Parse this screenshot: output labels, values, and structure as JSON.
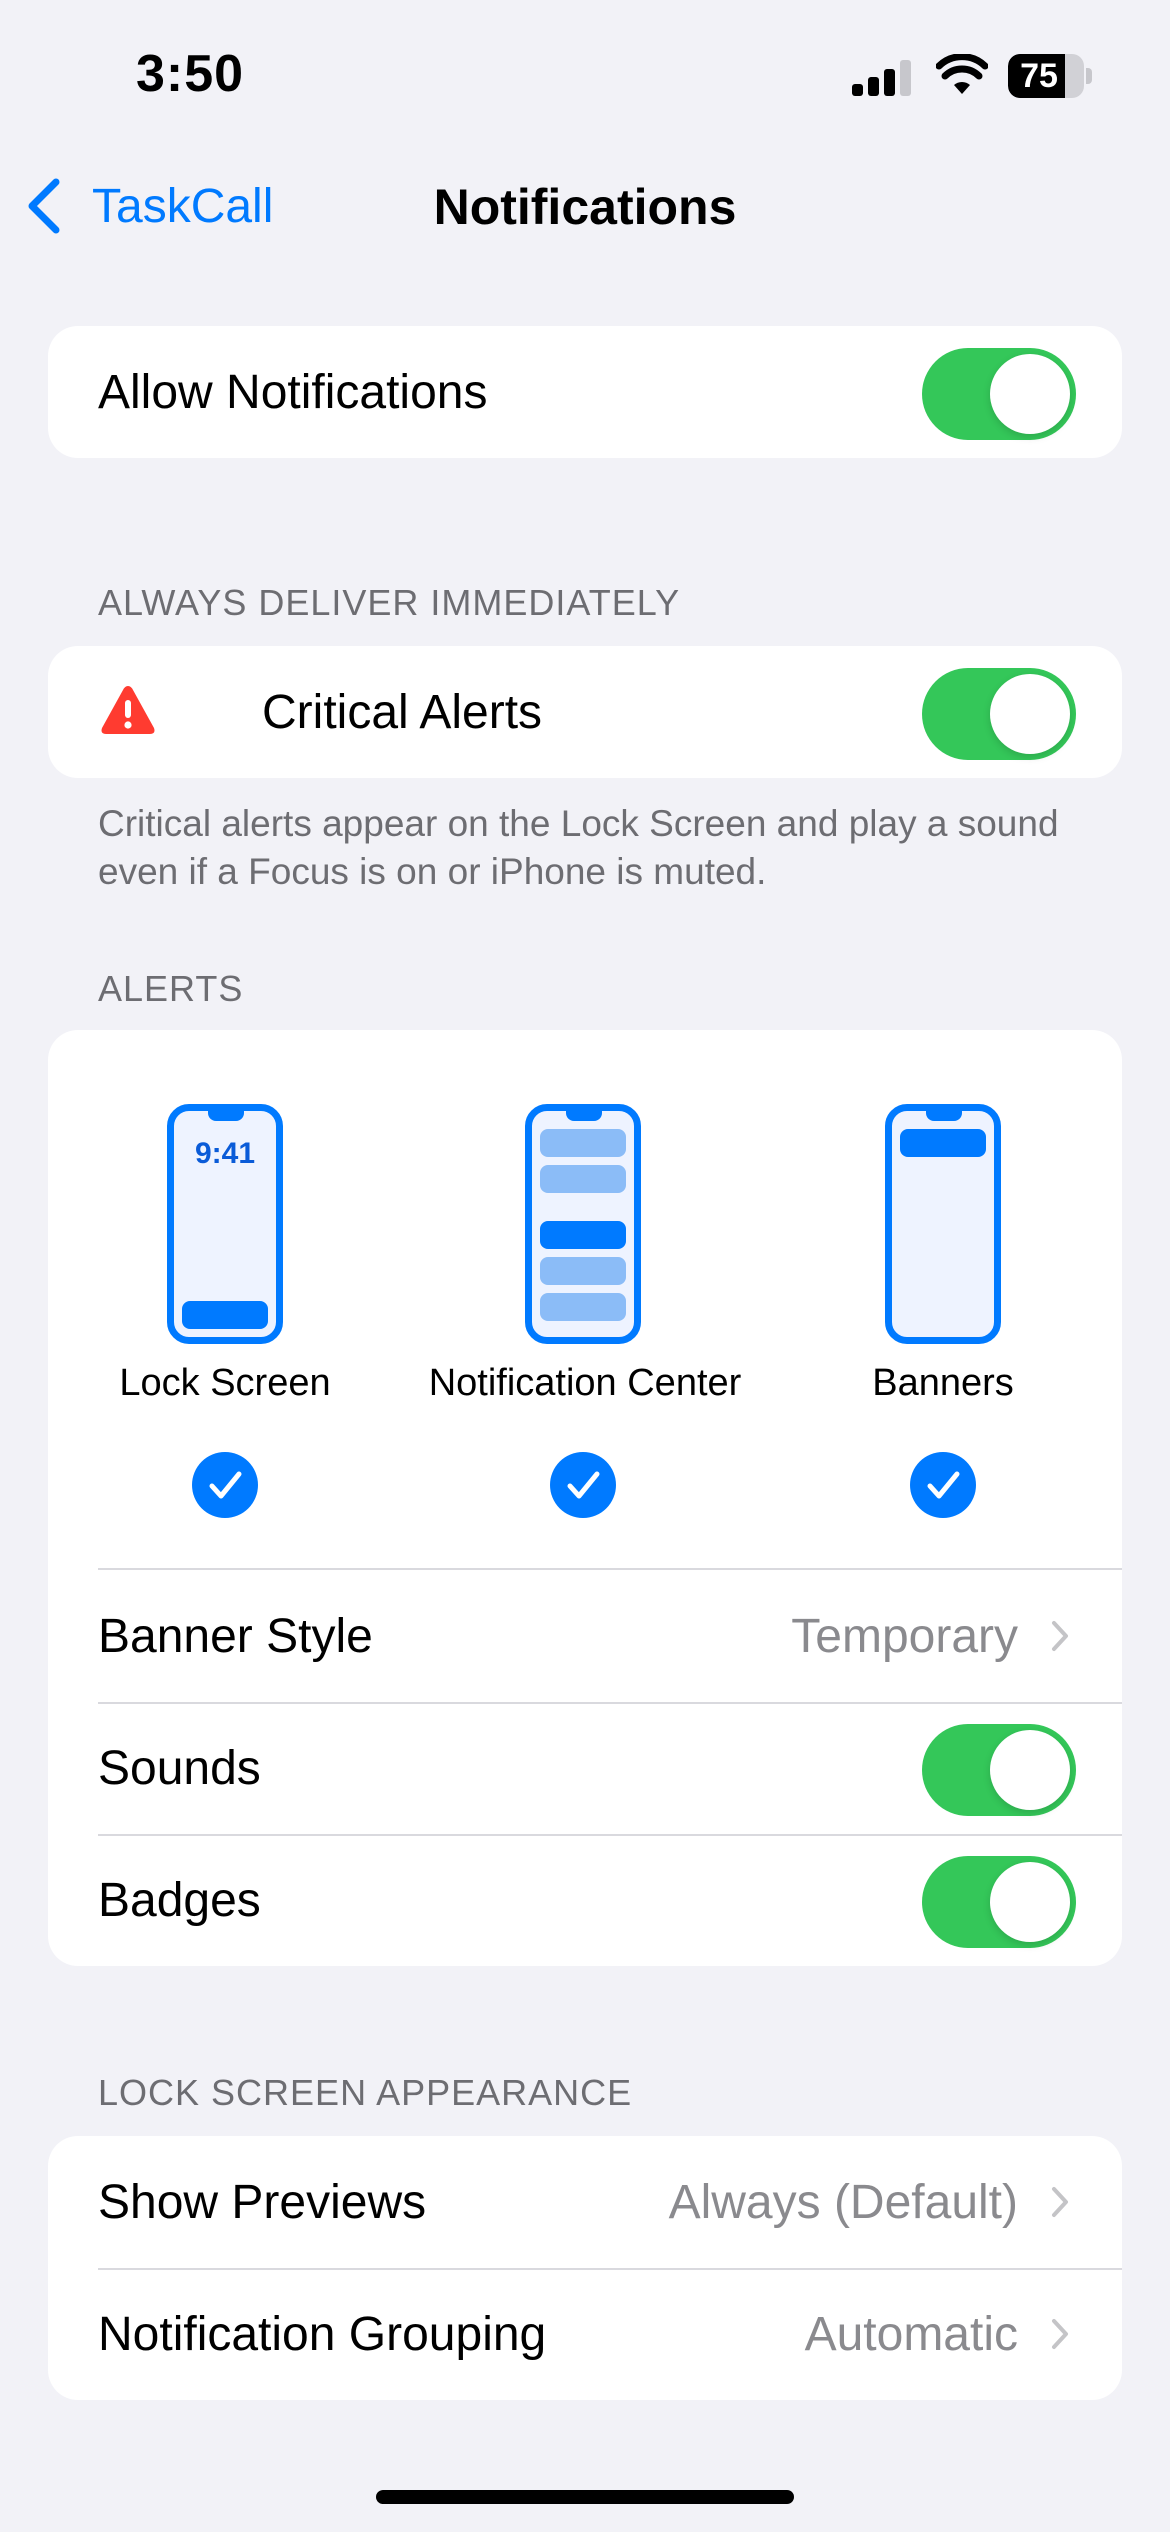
{
  "status_bar": {
    "time": "3:50",
    "battery_level": 75,
    "battery_text": "75"
  },
  "nav": {
    "back_label": "TaskCall",
    "title": "Notifications"
  },
  "allow": {
    "label": "Allow Notifications",
    "on": true
  },
  "always_deliver": {
    "header": "ALWAYS DELIVER IMMEDIATELY",
    "critical_label": "Critical Alerts",
    "critical_on": true,
    "note": "Critical alerts appear on the Lock Screen and play a sound even if a Focus is on or iPhone is muted."
  },
  "alerts": {
    "header": "ALERTS",
    "options": [
      {
        "label": "Lock Screen",
        "clock": "9:41",
        "checked": true
      },
      {
        "label": "Notification Center",
        "checked": true
      },
      {
        "label": "Banners",
        "checked": true
      }
    ],
    "banner_style_label": "Banner Style",
    "banner_style_value": "Temporary",
    "sounds_label": "Sounds",
    "sounds_on": true,
    "badges_label": "Badges",
    "badges_on": true
  },
  "lock_screen": {
    "header": "LOCK SCREEN APPEARANCE",
    "previews_label": "Show Previews",
    "previews_value": "Always (Default)",
    "grouping_label": "Notification Grouping",
    "grouping_value": "Automatic"
  },
  "colors": {
    "accent": "#007aff",
    "toggle_on": "#34c759",
    "warning": "#ff3b30",
    "background": "#f2f2f7"
  },
  "icons": [
    "back-chevron-icon",
    "signal-icon",
    "wifi-icon",
    "battery-icon",
    "warning-triangle-icon",
    "checkmark-icon",
    "chevron-right-icon"
  ]
}
